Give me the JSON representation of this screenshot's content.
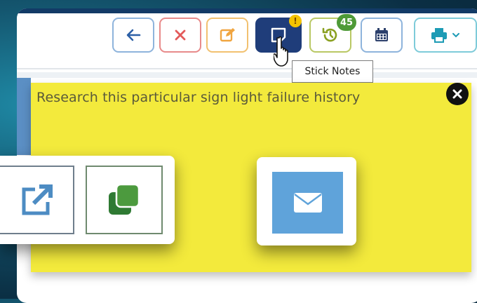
{
  "toolbar": {
    "buttons": [
      {
        "id": "back",
        "icon": "arrow-left-icon",
        "color": "#2b5fa6"
      },
      {
        "id": "cancel",
        "icon": "x-icon",
        "color": "#e35a5a"
      },
      {
        "id": "edit",
        "icon": "edit-icon",
        "color": "#f0a540"
      },
      {
        "id": "sticky-notes",
        "icon": "sticky-note-icon",
        "color": "#1f3d7a",
        "badge": "!"
      },
      {
        "id": "history",
        "icon": "history-icon",
        "color": "#8aa020",
        "badge": "45"
      },
      {
        "id": "calendar",
        "icon": "calendar-icon",
        "color": "#2b5fa6"
      },
      {
        "id": "print",
        "icon": "printer-icon",
        "color": "#1d9bb5"
      }
    ]
  },
  "tooltip": {
    "text": "Stick Notes"
  },
  "note": {
    "text": "Research this particular sign light failure history",
    "bg": "#f3ea3c"
  },
  "actions": {
    "open_icon": "external-link-icon",
    "copy_icon": "copy-icon",
    "mail_icon": "envelope-icon"
  }
}
